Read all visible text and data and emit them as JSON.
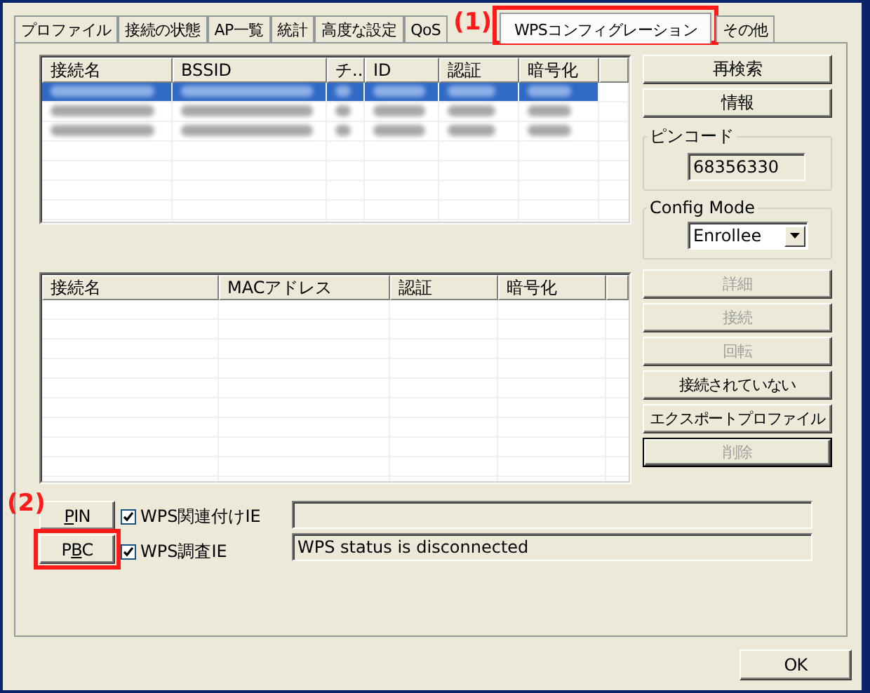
{
  "tabs": [
    {
      "label": "プロファイル",
      "selected": false
    },
    {
      "label": "接続の状態",
      "selected": false
    },
    {
      "label": "AP一覧",
      "selected": false
    },
    {
      "label": "統計",
      "selected": false
    },
    {
      "label": "高度な設定",
      "selected": false
    },
    {
      "label": "QoS",
      "selected": false
    },
    {
      "label": "WPSコンフィグレーション",
      "selected": true,
      "annotation": "(1)"
    },
    {
      "label": "その他",
      "selected": false
    }
  ],
  "ap_table": {
    "columns": [
      "接続名",
      "BSSID",
      "チ...",
      "ID",
      "認証",
      "暗号化"
    ],
    "rows": [
      {
        "kind": "blurred",
        "selected": true
      },
      {
        "kind": "blurred",
        "selected": false
      },
      {
        "kind": "blurred",
        "selected": false
      }
    ]
  },
  "profile_table": {
    "columns": [
      "接続名",
      "MACアドレス",
      "認証",
      "暗号化"
    ]
  },
  "side_buttons": [
    {
      "label": "再検索",
      "disabled": false
    },
    {
      "label": "情報",
      "disabled": false
    }
  ],
  "pin_code": {
    "label": "ピンコード",
    "value": "68356330"
  },
  "config_mode": {
    "label": "Config Mode",
    "value": "Enrollee"
  },
  "action_buttons": [
    {
      "label": "詳細",
      "disabled": true,
      "default": false
    },
    {
      "label": "接続",
      "disabled": true,
      "default": false
    },
    {
      "label": "回転",
      "disabled": true,
      "default": false
    },
    {
      "label": "接続されていない",
      "disabled": false,
      "default": false
    },
    {
      "label": "エクスポートプロファイル",
      "disabled": false,
      "default": false
    },
    {
      "label": "削除",
      "disabled": true,
      "default": true
    }
  ],
  "wps_buttons": [
    {
      "label_parts": [
        {
          "text": "P",
          "underlined": true
        },
        {
          "text": "IN",
          "underlined": false
        }
      ],
      "annotation": "(2)",
      "highlighted": false
    },
    {
      "label_parts": [
        {
          "text": "P",
          "underlined": false
        },
        {
          "text": "B",
          "underlined": true
        },
        {
          "text": "C",
          "underlined": false
        }
      ],
      "highlighted": true
    }
  ],
  "checkboxes": [
    {
      "label": "WPS関連付けIE",
      "checked": true
    },
    {
      "label": "WPS調査IE",
      "checked": true
    }
  ],
  "status_fields": [
    {
      "kind": "blank"
    },
    {
      "kind": "text",
      "value": "WPS status is disconnected"
    }
  ],
  "ok_button": "OK"
}
